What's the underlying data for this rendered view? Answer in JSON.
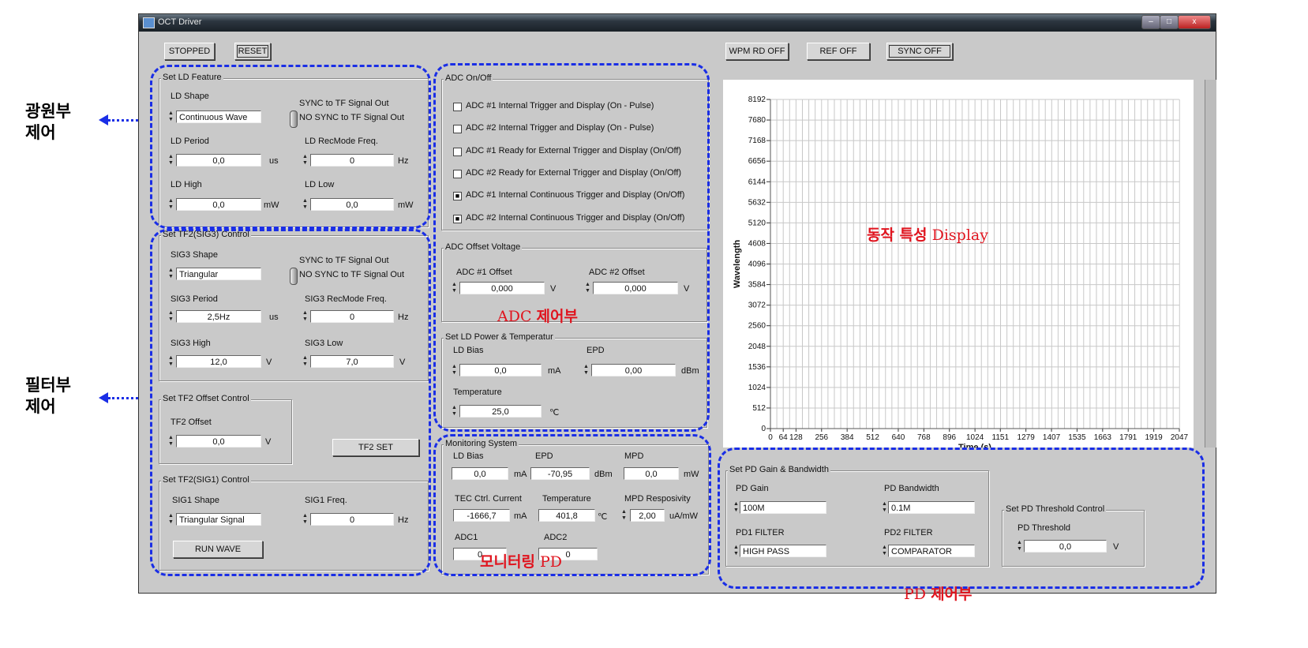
{
  "window": {
    "title": "OCT Driver",
    "min": "–",
    "max": "□",
    "close": "x"
  },
  "toolbar": {
    "stopped": "STOPPED",
    "reset": "RESET",
    "wpm": "WPM RD OFF",
    "ref": "REF OFF",
    "sync": "SYNC OFF"
  },
  "ld_feature": {
    "title": "Set LD Feature",
    "shape_label": "LD Shape",
    "shape": "Continuous Wave",
    "sync_on": "SYNC to TF Signal Out",
    "sync_off": "NO SYNC to TF Signal Out",
    "period_label": "LD Period",
    "period": "0,0",
    "period_unit": "us",
    "rec_label": "LD RecMode Freq.",
    "rec": "0",
    "rec_unit": "Hz",
    "high_label": "LD High",
    "high": "0,0",
    "high_unit": "mW",
    "low_label": "LD Low",
    "low": "0,0",
    "low_unit": "mW"
  },
  "sig3": {
    "title": "Set TF2(SIG3) Control",
    "shape_label": "SIG3 Shape",
    "shape": "Triangular",
    "sync_on": "SYNC to TF Signal Out",
    "sync_off": "NO SYNC to TF Signal Out",
    "period_label": "SIG3 Period",
    "period": "2,5Hz",
    "period_unit": "us",
    "rec_label": "SIG3 RecMode Freq.",
    "rec": "0",
    "rec_unit": "Hz",
    "high_label": "SIG3 High",
    "high": "12,0",
    "high_unit": "V",
    "low_label": "SIG3 Low",
    "low": "7,0",
    "low_unit": "V"
  },
  "tf2_offset": {
    "title": "Set TF2 Offset Control",
    "label": "TF2 Offset",
    "value": "0,0",
    "unit": "V",
    "set": "TF2 SET"
  },
  "sig1": {
    "title": "Set TF2(SIG1) Control",
    "shape_label": "SIG1 Shape",
    "shape": "Triangular Signal",
    "freq_label": "SIG1 Freq.",
    "freq": "0",
    "freq_unit": "Hz",
    "run": "RUN WAVE"
  },
  "adc_onoff": {
    "title": "ADC On/Off",
    "items": [
      {
        "label": "ADC #1 Internal Trigger and Display (On - Pulse)",
        "checked": false
      },
      {
        "label": "ADC #2 Internal Trigger and Display (On - Pulse)",
        "checked": false
      },
      {
        "label": "ADC #1 Ready for External Trigger and Display (On/Off)",
        "checked": false
      },
      {
        "label": "ADC #2 Ready for External Trigger and Display (On/Off)",
        "checked": false
      },
      {
        "label": "ADC #1 Internal Continuous Trigger and Display (On/Off)",
        "checked": true
      },
      {
        "label": "ADC #2 Internal Continuous Trigger and Display (On/Off)",
        "checked": true
      }
    ]
  },
  "adc_offset": {
    "title": "ADC Offset Voltage",
    "a1_label": "ADC #1 Offset",
    "a1": "0,000",
    "a2_label": "ADC #2 Offset",
    "a2": "0,000",
    "unit": "V"
  },
  "ld_power": {
    "title": "Set LD Power & Temperatur",
    "bias_label": "LD Bias",
    "bias": "0,0",
    "bias_unit": "mA",
    "epd_label": "EPD",
    "epd": "0,00",
    "epd_unit": "dBm",
    "temp_label": "Temperature",
    "temp": "25,0",
    "temp_unit": "℃"
  },
  "monitor": {
    "title": "Monitoring System",
    "bias_label": "LD Bias",
    "bias": "0,0",
    "bias_unit": "mA",
    "epd_label": "EPD",
    "epd": "-70,95",
    "epd_unit": "dBm",
    "mpd_label": "MPD",
    "mpd": "0,0",
    "mpd_unit": "mW",
    "tec_label": "TEC Ctrl. Current",
    "tec": "-1666,7",
    "tec_unit": "mA",
    "temp_label": "Temperature",
    "temp": "401,8",
    "temp_unit": "℃",
    "resp_label": "MPD Resposivity",
    "resp": "2,00",
    "resp_unit": "uA/mW",
    "adc1_label": "ADC1",
    "adc1": "0",
    "adc2_label": "ADC2",
    "adc2": "0"
  },
  "pd_gain": {
    "title": "Set PD Gain & Bandwidth",
    "gain_label": "PD Gain",
    "gain": "100M",
    "bw_label": "PD Bandwidth",
    "bw": "0.1M",
    "f1_label": "PD1 FILTER",
    "f1": "HIGH PASS",
    "f2_label": "PD2 FILTER",
    "f2": "COMPARATOR"
  },
  "pd_thresh": {
    "title": "Set PD Threshold Control",
    "label": "PD Threshold",
    "value": "0,0",
    "unit": "V"
  },
  "annotations": {
    "light": [
      "광원부",
      "제어"
    ],
    "filter": [
      "필터부",
      "제어"
    ],
    "display_ko": "동작 특성",
    "display_en": "Display",
    "adc_en": "ADC",
    "adc_ko": "제어부",
    "mon_ko": "모니터링",
    "mon_en": "PD",
    "pd_en": "PD",
    "pd_ko": "제어부",
    "accent": "#1a2ee6",
    "red": "#e0141e"
  },
  "chart_data": {
    "type": "line",
    "xlabel": "Time (s)",
    "ylabel": "Wavelength",
    "xlim": [
      0,
      2047
    ],
    "ylim": [
      0,
      8192
    ],
    "grid": true,
    "xticks": [
      "0",
      "64",
      "128",
      "256",
      "384",
      "512",
      "640",
      "768",
      "896",
      "1024",
      "1151",
      "1279",
      "1407",
      "1535",
      "1663",
      "1791",
      "1919",
      "2047"
    ],
    "yticks": [
      "0",
      "512",
      "1024",
      "1536",
      "2048",
      "2560",
      "3072",
      "3584",
      "4096",
      "4608",
      "5120",
      "5632",
      "6144",
      "6656",
      "7168",
      "7680",
      "8192"
    ],
    "series": []
  }
}
